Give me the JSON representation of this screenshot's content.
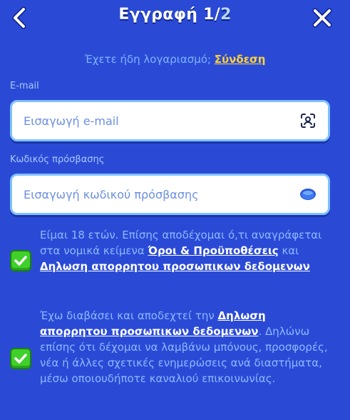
{
  "header": {
    "title_prefix": "Εγγραφή 1/",
    "title_total": "2"
  },
  "login": {
    "prompt": "Έχετε ήδη λογαριασμό;",
    "link": "Σύνδεση"
  },
  "email": {
    "label": "E-mail",
    "placeholder": "Εισαγωγή e-mail",
    "value": ""
  },
  "password": {
    "label": "Κωδικός πρόσβασης",
    "placeholder": "Εισαγωγή κωδικού πρόσβασης",
    "value": ""
  },
  "consent_age": {
    "checked": true,
    "text_1": "Είμαι 18 ετών. Επίσης αποδέχομαι ό,τι αναγράφεται στα νομικά κείμενα ",
    "link_terms": "Όροι & Προϋποθέσεις",
    "text_2": " και ",
    "link_privacy": "Δηλωση απορρητου προσωπικων δεδομενων"
  },
  "consent_marketing": {
    "checked": true,
    "text_1": "Έχω διαβάσει και αποδεχτεί την ",
    "link_privacy": "Δηλωση απορρητου προσωπικων δεδομενων",
    "text_2": ". Δηλώνω επίσης ότι δέχομαι να λαμβάνω μπόνους, προσφορές, νέα ή άλλες σχετικές ενημερώσεις ανά διαστήματα, μέσω οποιουδήποτε καναλιού επικοινωνίας."
  },
  "colors": {
    "background": "#2a4ad6",
    "accent_link": "#ffd23a",
    "checkbox": "#3fd12a"
  },
  "icons": {
    "back": "chevron-left-icon",
    "close": "close-x-icon",
    "email_field": "face-scan-icon",
    "password_field": "eye-icon",
    "checkbox": "checkmark-icon"
  }
}
